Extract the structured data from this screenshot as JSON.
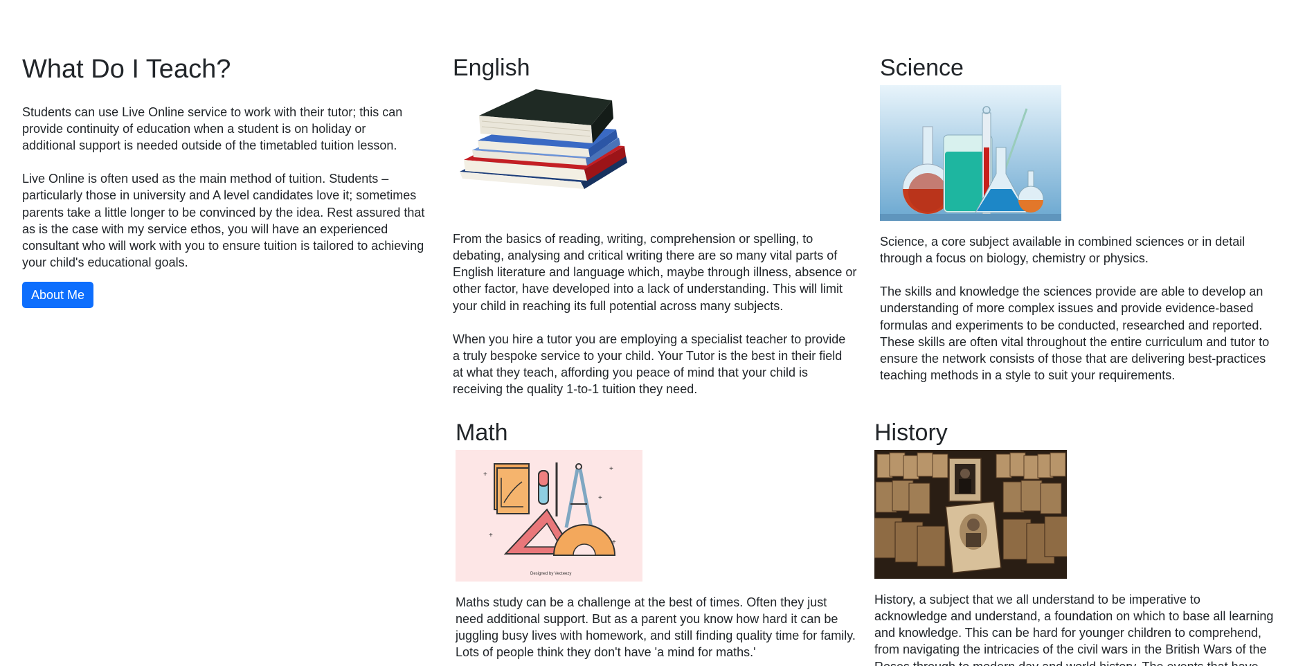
{
  "intro": {
    "title": "What Do I Teach?",
    "paragraph1": "Students can use Live Online service to work with their tutor; this can provide continuity of education when a student is on holiday or additional support is needed outside of the timetabled tuition lesson.",
    "paragraph2": "Live Online is often used as the main method of tuition. Students – particularly those in university and A level candidates love it; sometimes parents take a little longer to be convinced by the idea. Rest assured that as is the case with my service ethos, you will have an experienced consultant who will work with you to ensure tuition is tailored to achieving your child's educational goals.",
    "button_label": "About Me"
  },
  "subjects": {
    "english": {
      "title": "English",
      "image_alt": "stack-of-books",
      "paragraph1": "From the basics of reading, writing, comprehension or spelling, to debating, analysing and critical writing there are so many vital parts of English literature and language which, maybe through illness, absence or other factor, have developed into a lack of understanding. This will limit your child in reaching its full potential across many subjects.",
      "paragraph2": "When you hire a tutor you are employing a specialist teacher to provide a truly bespoke service to your child. Your Tutor is the best in their field at what they teach, affording you peace of mind that your child is receiving the quality 1-to-1 tuition they need."
    },
    "science": {
      "title": "Science",
      "image_alt": "laboratory-glassware",
      "paragraph1": "Science, a core subject available in combined sciences or in detail through a focus on biology, chemistry or physics.",
      "paragraph2": "The skills and knowledge the sciences provide are able to develop an understanding of more complex issues and provide evidence-based formulas and experiments to be conducted, researched and reported. These skills are often vital throughout the entire curriculum and tutor to ensure the network consists of those that are delivering best-practices teaching methods in a style to suit your requirements."
    },
    "math": {
      "title": "Math",
      "image_alt": "math-tools-illustration",
      "image_caption": "Designed by Vecteezy",
      "paragraph1": "Maths study can be a challenge at the best of times. Often they just need additional support. But as a parent you know how hard it can be juggling busy lives with homework, and still finding quality time for family. Lots of people think they don't have 'a mind for maths.'"
    },
    "history": {
      "title": "History",
      "image_alt": "old-photographs-archive",
      "paragraph1": "History, a subject that we all understand to be imperative to acknowledge and understand, a foundation on which to base all learning and knowledge. This can be hard for younger children to comprehend, from navigating the intricacies of the civil wars in the British Wars of the Roses through to modern day and world history. The events that have happened allow context and understanding of the"
    }
  },
  "colors": {
    "text": "#212529",
    "button": "#0d6efd"
  }
}
